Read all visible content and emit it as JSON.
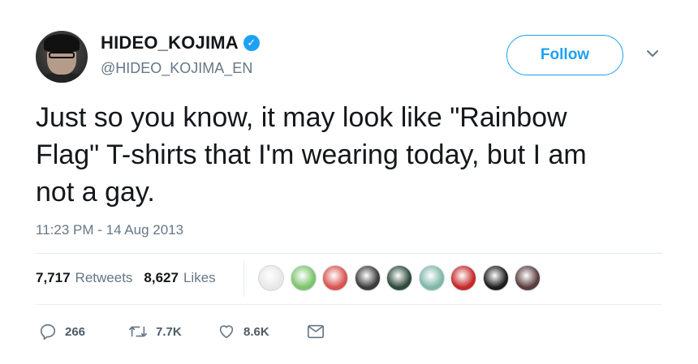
{
  "author": {
    "display_name": "HIDEO_KOJIMA",
    "handle": "@HIDEO_KOJIMA_EN",
    "verified": true,
    "verified_badge_color": "#1da1f2"
  },
  "follow_button": {
    "label": "Follow",
    "color": "#1da1f2"
  },
  "tweet": {
    "text": "Just so you know, it may look like \"Rainbow\nFlag\" T-shirts that I'm wearing today, but I am\nnot a gay.",
    "timestamp": "11:23 PM - 14 Aug 2013"
  },
  "stats": {
    "retweets_count": "7,717",
    "retweets_label": "Retweets",
    "likes_count": "8,627",
    "likes_label": "Likes"
  },
  "liker_avatars": [
    {
      "name": "liker-avatar-1",
      "color": "#e8e8e8"
    },
    {
      "name": "liker-avatar-2",
      "color": "#7cc46b"
    },
    {
      "name": "liker-avatar-3",
      "color": "#d9534f"
    },
    {
      "name": "liker-avatar-4",
      "color": "#3b3b3b"
    },
    {
      "name": "liker-avatar-5",
      "color": "#2e4a3a"
    },
    {
      "name": "liker-avatar-6",
      "color": "#7fb7a9"
    },
    {
      "name": "liker-avatar-7",
      "color": "#c62828"
    },
    {
      "name": "liker-avatar-8",
      "color": "#1d1d1d"
    },
    {
      "name": "liker-avatar-9",
      "color": "#5a3d3d"
    }
  ],
  "actions": {
    "reply_count": "266",
    "retweet_count": "7.7K",
    "like_count": "8.6K",
    "icons": [
      "reply-icon",
      "retweet-icon",
      "like-icon",
      "direct-message-icon"
    ]
  }
}
